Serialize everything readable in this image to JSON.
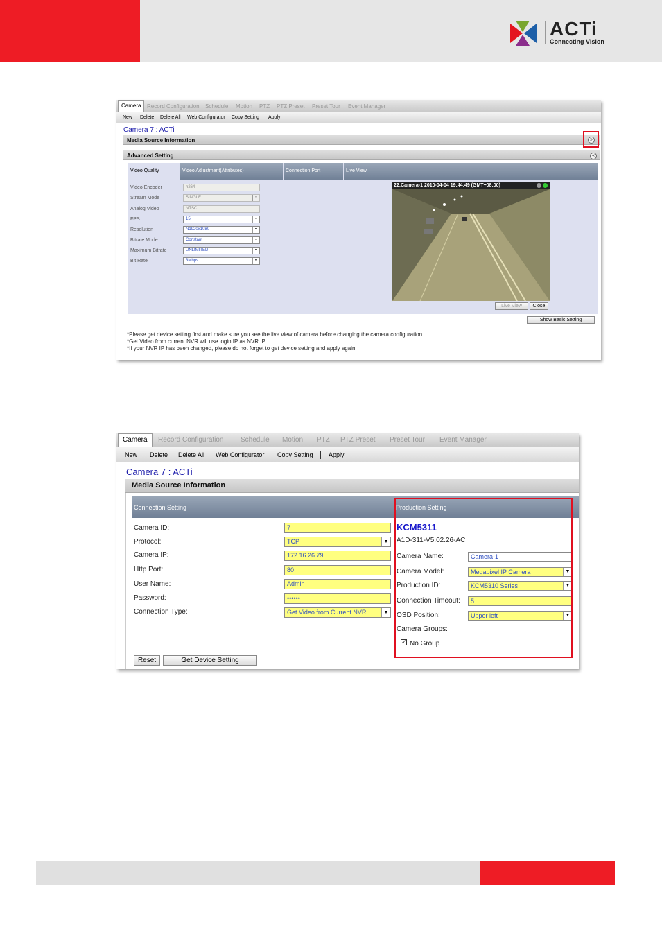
{
  "header": {
    "logo_text": "ACTi",
    "logo_sub": "Connecting Vision"
  },
  "shot1": {
    "tabs": [
      "Camera",
      "Record Configuration",
      "Schedule",
      "Motion",
      "PTZ",
      "PTZ Preset",
      "Preset Tour",
      "Event Manager"
    ],
    "toolbar": [
      "New",
      "Delete",
      "Delete All",
      "Web Configurator",
      "Copy Setting",
      "Apply"
    ],
    "camera_title": "Camera 7 : ACTi",
    "media_section": "Media Source Information",
    "advanced_section": "Advanced Setting",
    "columns": [
      "Video Quality",
      "Video Adjustment(Attributes)",
      "Connection Port",
      "Live View"
    ],
    "fields": [
      {
        "label": "Video Encoder",
        "value": "h264"
      },
      {
        "label": "Stream Mode",
        "value": "SINGLE"
      },
      {
        "label": "Analog Video",
        "value": "NTSC"
      },
      {
        "label": "FPS",
        "value": "15"
      },
      {
        "label": "Resolution",
        "value": "N1920x1080"
      },
      {
        "label": "Bitrate Mode",
        "value": "Constant"
      },
      {
        "label": "Maximum Bitrate",
        "value": "UNLIMITED"
      },
      {
        "label": "Bit Rate",
        "value": "3Mbps"
      }
    ],
    "live_caption": "22:Camera-1   2010-04-04 19:44:49 (GMT+08:00)",
    "live_view_button": "Live View",
    "close_button": "Close",
    "show_basic_button": "Show Basic Setting",
    "notes": [
      "*Please get device setting first and make sure you see the live view of camera before changing the camera configuration.",
      "*Get Video from current NVR will use login IP as NVR IP.",
      "*If your NVR IP has been changed, please do not forget to get device setting and apply again."
    ]
  },
  "shot2": {
    "tabs": [
      "Camera",
      "Record Configuration",
      "Schedule",
      "Motion",
      "PTZ",
      "PTZ Preset",
      "Preset Tour",
      "Event Manager"
    ],
    "toolbar": [
      "New",
      "Delete",
      "Delete All",
      "Web Configurator",
      "Copy Setting",
      "Apply"
    ],
    "camera_title": "Camera 7 : ACTi",
    "media_section": "Media Source Information",
    "connection_head": "Connection Setting",
    "production_head": "Production Setting",
    "connection_fields": [
      {
        "label": "Camera ID:",
        "value": "7"
      },
      {
        "label": "Protocol:",
        "value": "TCP"
      },
      {
        "label": "Camera IP:",
        "value": "172.16.26.79"
      },
      {
        "label": "Http Port:",
        "value": "80"
      },
      {
        "label": "User Name:",
        "value": "Admin"
      },
      {
        "label": "Password:",
        "value": "••••••"
      },
      {
        "label": "Connection Type:",
        "value": "Get Video from Current NVR"
      }
    ],
    "model_name": "KCM5311",
    "firmware": "A1D-311-V5.02.26-AC",
    "production_fields": [
      {
        "label": "Camera Name:",
        "value": "Camera-1"
      },
      {
        "label": "Camera Model:",
        "value": "Megapixel IP Camera"
      },
      {
        "label": "Production ID:",
        "value": "KCM5310 Series"
      },
      {
        "label": "Connection Timeout:",
        "value": "5"
      },
      {
        "label": "OSD Position:",
        "value": "Upper left"
      }
    ],
    "camera_groups_label": "Camera Groups:",
    "no_group_label": "No Group",
    "reset_button": "Reset",
    "get_device_button": "Get Device Setting"
  }
}
